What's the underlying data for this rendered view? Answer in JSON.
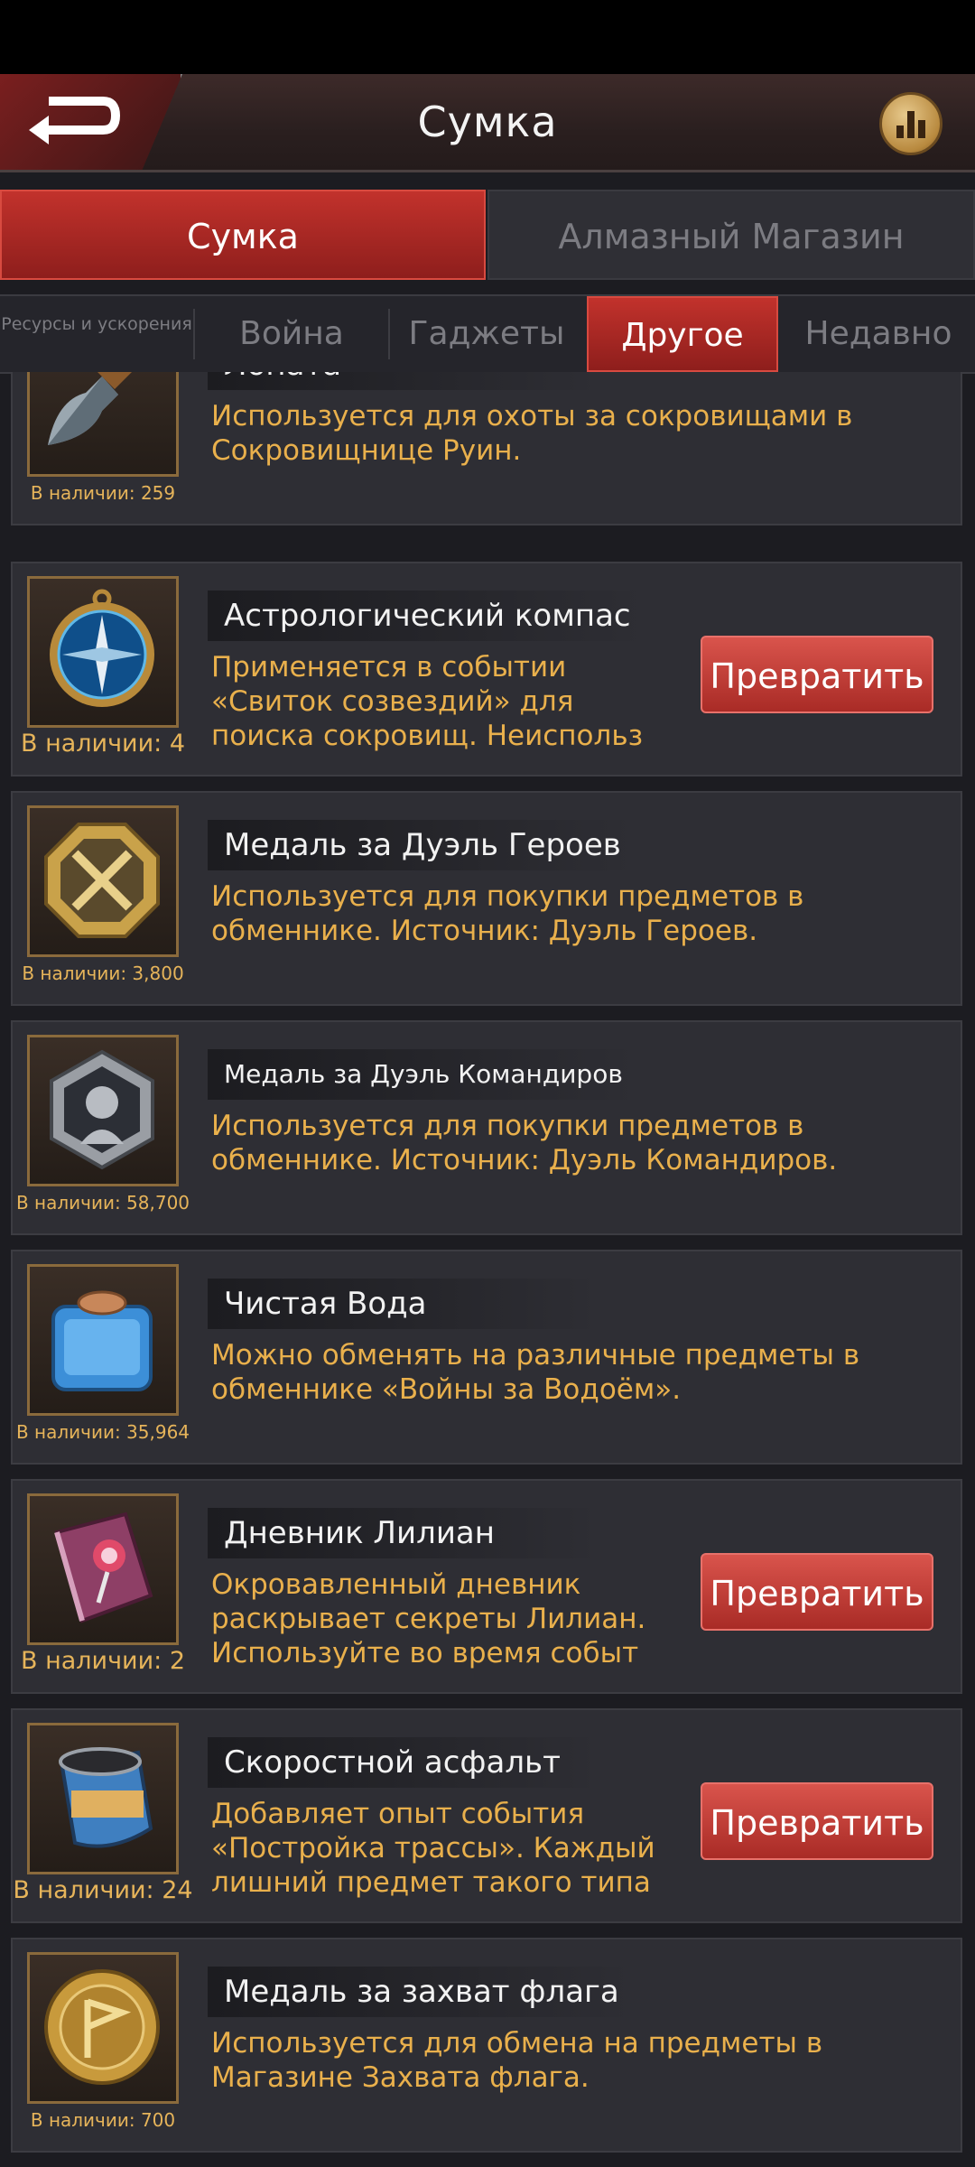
{
  "header": {
    "title": "Сумка"
  },
  "main_tabs": [
    {
      "label": "Сумка"
    },
    {
      "label": "Алмазный Магазин"
    }
  ],
  "sub_tabs": [
    {
      "label": "Ресурсы и ускорения"
    },
    {
      "label": "Война"
    },
    {
      "label": "Гаджеты"
    },
    {
      "label": "Другое"
    },
    {
      "label": "Недавно"
    }
  ],
  "items": [
    {
      "name": "Лопата",
      "desc": "Используется для охоты за сокровищами в Сокровищнице Руин.",
      "count": "В наличии: 259",
      "icon": "shovel-icon"
    },
    {
      "name": "Астрологический компас",
      "desc": "Применяется в событии «Свиток созвездий» для поиска сокровищ. Неиспольз",
      "count": "В наличии: 4",
      "button": "Превратить",
      "icon": "compass-icon"
    },
    {
      "name": "Медаль за Дуэль Героев",
      "desc": "Используется для покупки предметов в обменнике. Источник: Дуэль Героев.",
      "count": "В наличии: 3,800",
      "icon": "hero-duel-medal-icon"
    },
    {
      "name": "Медаль за Дуэль Командиров",
      "desc": "Используется для покупки предметов в обменнике. Источник: Дуэль Командиров.",
      "count": "В наличии: 58,700",
      "icon": "commander-duel-medal-icon"
    },
    {
      "name": "Чистая Вода",
      "desc": "Можно обменять на различные предметы в обменнике «Войны за Водоём».",
      "count": "В наличии: 35,964",
      "icon": "water-tank-icon"
    },
    {
      "name": "Дневник Лилиан",
      "desc": "Окровавленный дневник раскрывает секреты Лилиан. Используйте во время событ",
      "count": "В наличии: 2",
      "button": "Превратить",
      "icon": "diary-icon"
    },
    {
      "name": "Скоростной асфальт",
      "desc": "Добавляет опыт события «Постройка трассы». Каждый лишний предмет такого типа",
      "count": "В наличии: 24",
      "button": "Превратить",
      "icon": "asphalt-bucket-icon"
    },
    {
      "name": "Медаль за захват флага",
      "desc": "Используется для обмена на предметы в Магазине Захвата флага.",
      "count": "В наличии: 700",
      "icon": "flag-medal-icon"
    }
  ]
}
